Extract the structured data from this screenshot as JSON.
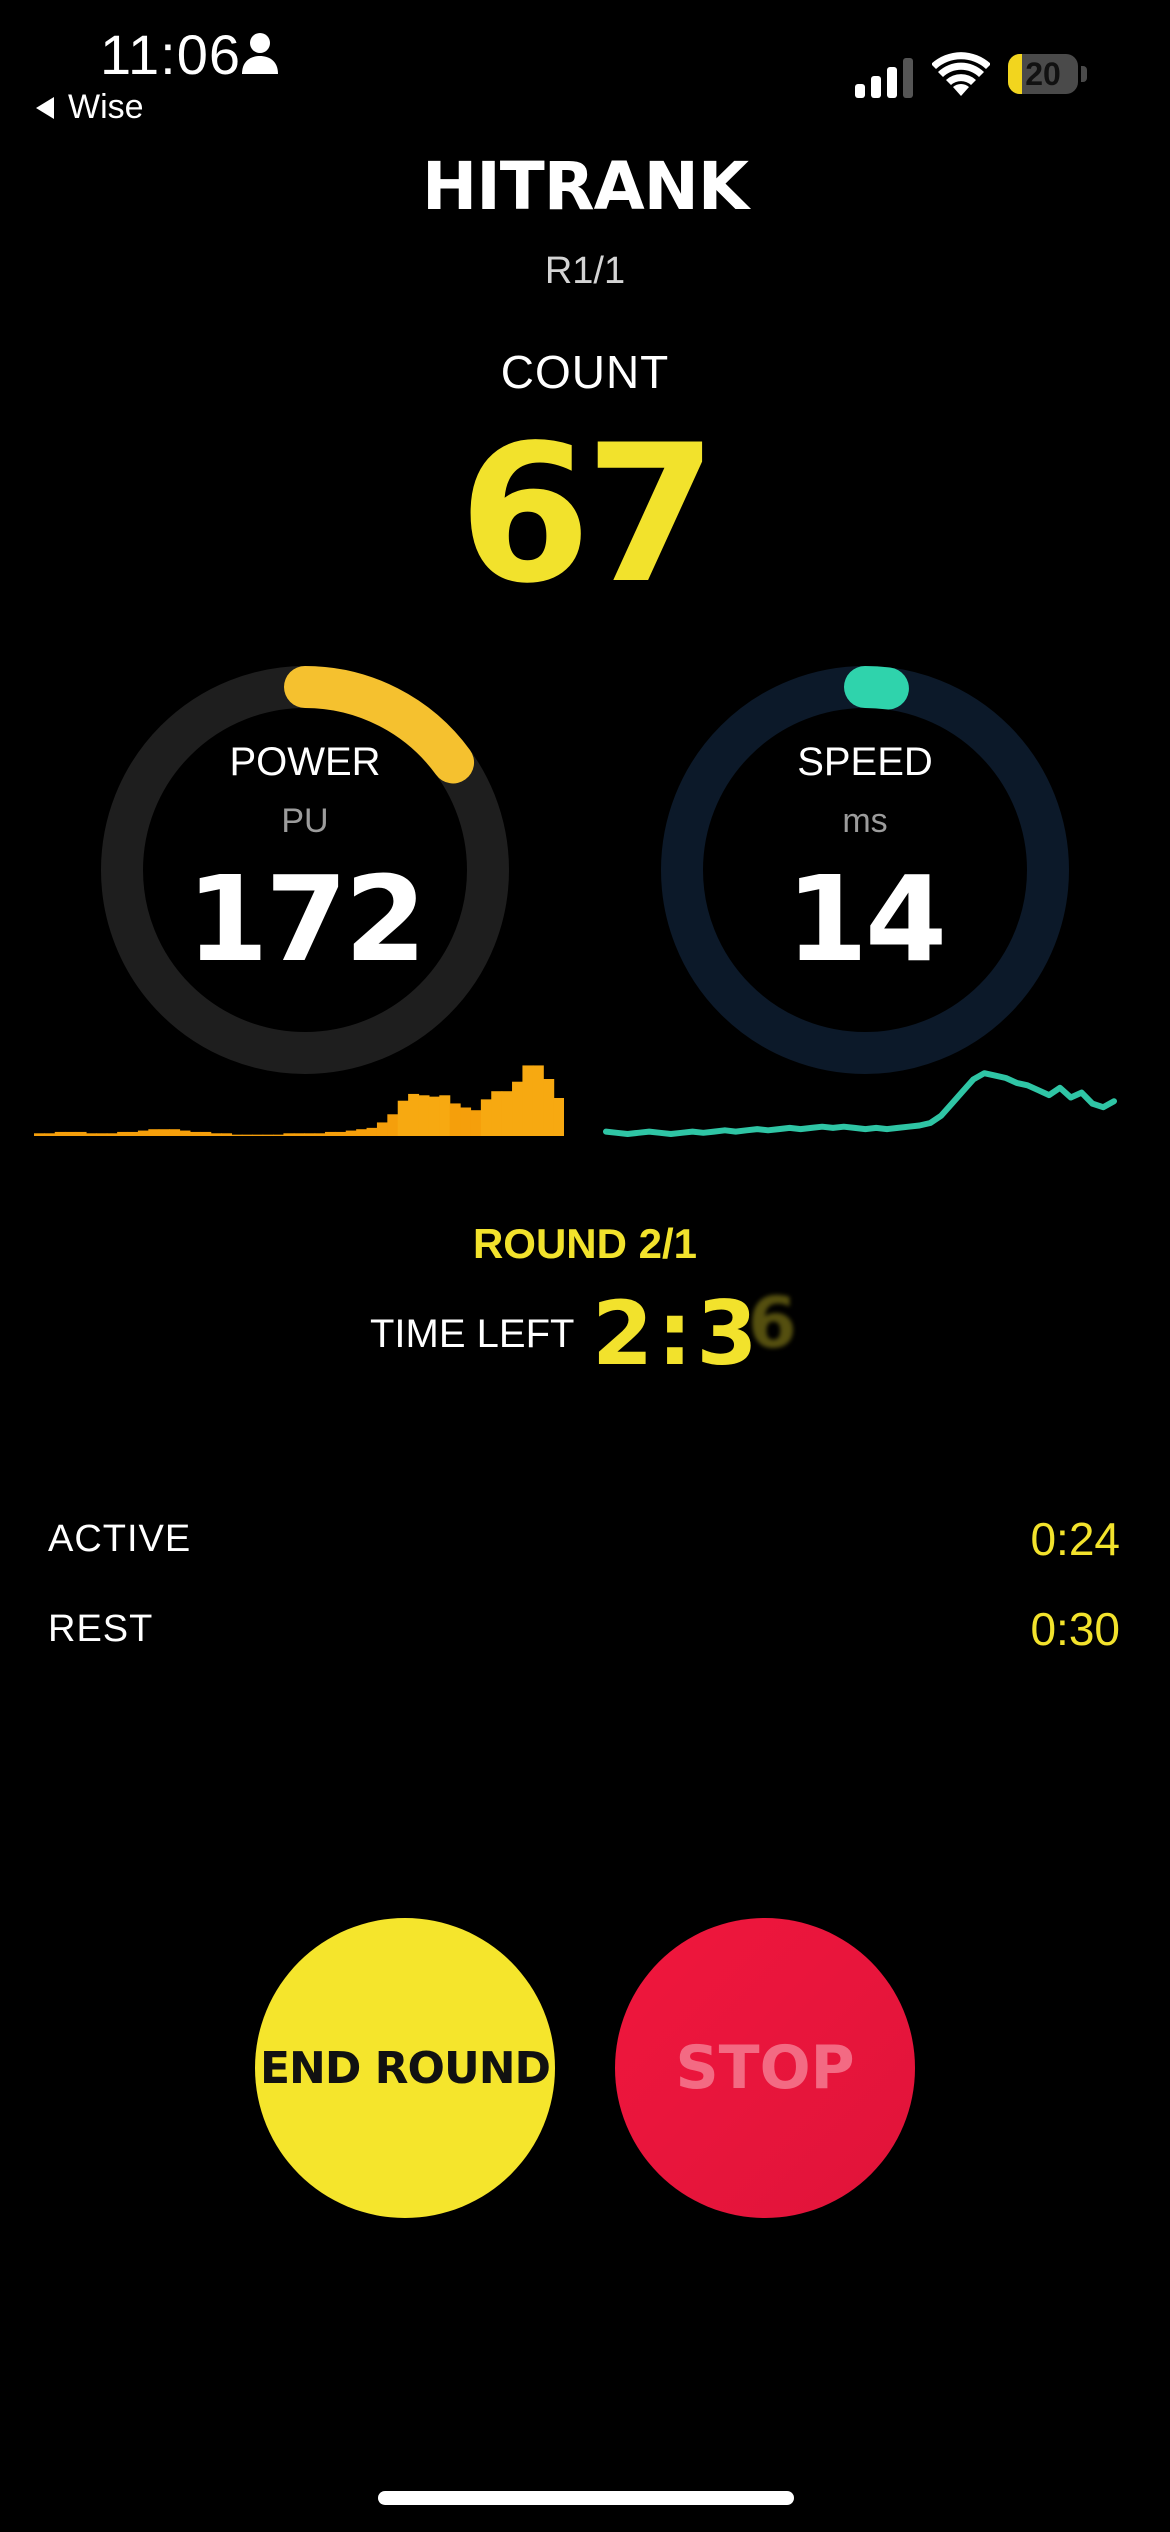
{
  "status_bar": {
    "time": "11:06",
    "back_app": "Wise",
    "battery_percent": "20",
    "battery_level": 0.2
  },
  "header": {
    "logo": "HITRANK",
    "round_code": "R1/1"
  },
  "count": {
    "label": "COUNT",
    "value": "67"
  },
  "power": {
    "label": "POWER",
    "unit": "PU",
    "value": "172",
    "ring_fraction": 0.15,
    "ring_color": "#f5c12f",
    "track_color": "#1e1e1e"
  },
  "speed": {
    "label": "SPEED",
    "unit": "ms",
    "value": "14",
    "ring_fraction": 0.02,
    "ring_color": "#2fd3ac",
    "track_color": "#0c1929"
  },
  "round": {
    "label": "ROUND 2/1",
    "time_left_label": "TIME LEFT",
    "time_left_value": "2:3",
    "time_left_next_digit": "6"
  },
  "intervals": {
    "active_label": "ACTIVE",
    "active_value": "0:24",
    "rest_label": "REST",
    "rest_value": "0:30"
  },
  "buttons": {
    "end_round": "END ROUND",
    "stop": "STOP"
  },
  "colors": {
    "accent_yellow": "#f2e22c",
    "stop_red": "#e8143c",
    "power_orange": "#f59f0b",
    "speed_teal": "#2fc5a5"
  },
  "chart_data": [
    {
      "type": "bar",
      "values": [
        2,
        2,
        3,
        3,
        3,
        2,
        2,
        2,
        3,
        3,
        4,
        5,
        5,
        5,
        4,
        3,
        3,
        2,
        2,
        1,
        1,
        1,
        1,
        1,
        2,
        2,
        2,
        2,
        3,
        3,
        4,
        5,
        6,
        10,
        16,
        26,
        31,
        30,
        29,
        30,
        24,
        21,
        19,
        27,
        33,
        33,
        40,
        52,
        52,
        42,
        28
      ],
      "ylim": [
        0,
        56
      ]
    },
    {
      "type": "line",
      "values": [
        58,
        59,
        60,
        59,
        58,
        59,
        60,
        59,
        58,
        59,
        58,
        57,
        58,
        57,
        56,
        57,
        56,
        55,
        56,
        55,
        54,
        55,
        54,
        55,
        56,
        55,
        56,
        55,
        54,
        53,
        51,
        45,
        35,
        25,
        15,
        10,
        12,
        14,
        18,
        20,
        24,
        28,
        22,
        30,
        26,
        35,
        38,
        33
      ],
      "ylim": [
        0,
        60
      ]
    }
  ]
}
